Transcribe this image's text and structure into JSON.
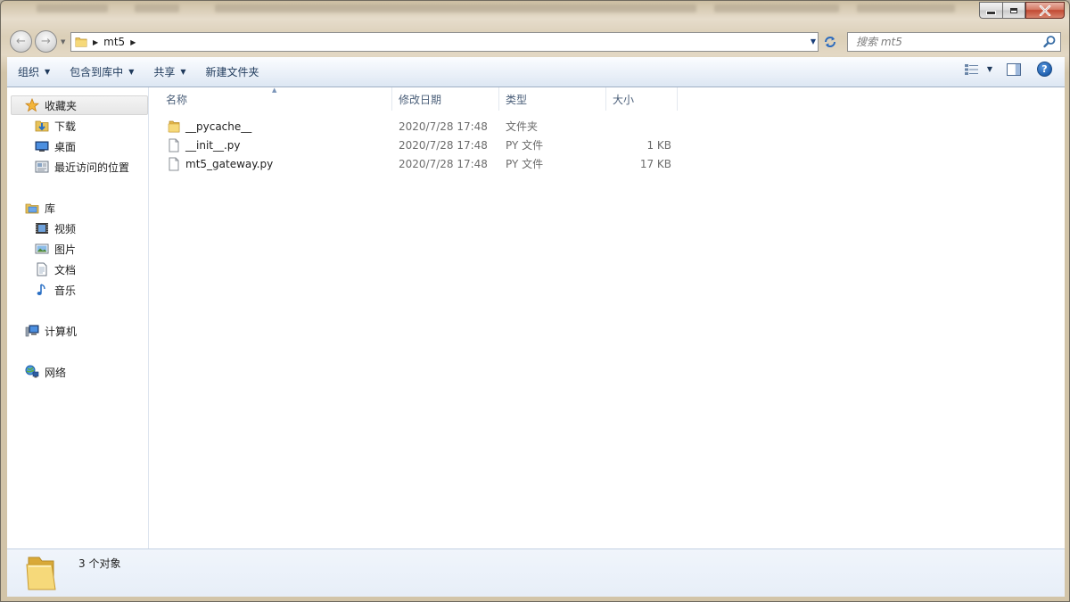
{
  "address": {
    "breadcrumbs": [
      "mt5"
    ],
    "search_placeholder": "搜索 mt5"
  },
  "toolbar": {
    "organize": "组织",
    "include_in_library": "包含到库中",
    "share": "共享",
    "new_folder": "新建文件夹"
  },
  "sidebar": {
    "favorites": {
      "label": "收藏夹",
      "items": [
        {
          "label": "下载",
          "icon": "download-folder-icon"
        },
        {
          "label": "桌面",
          "icon": "desktop-icon"
        },
        {
          "label": "最近访问的位置",
          "icon": "recent-places-icon"
        }
      ]
    },
    "libraries": {
      "label": "库",
      "items": [
        {
          "label": "视频",
          "icon": "videos-icon"
        },
        {
          "label": "图片",
          "icon": "pictures-icon"
        },
        {
          "label": "文档",
          "icon": "documents-icon"
        },
        {
          "label": "音乐",
          "icon": "music-icon"
        }
      ]
    },
    "computer": {
      "label": "计算机",
      "icon": "computer-icon"
    },
    "network": {
      "label": "网络",
      "icon": "network-icon"
    }
  },
  "columns": {
    "name": "名称",
    "date": "修改日期",
    "type": "类型",
    "size": "大小"
  },
  "files": [
    {
      "name": "__pycache__",
      "date": "2020/7/28 17:48",
      "type": "文件夹",
      "size": "",
      "icon": "folder-icon"
    },
    {
      "name": "__init__.py",
      "date": "2020/7/28 17:48",
      "type": "PY 文件",
      "size": "1 KB",
      "icon": "file-icon"
    },
    {
      "name": "mt5_gateway.py",
      "date": "2020/7/28 17:48",
      "type": "PY 文件",
      "size": "17 KB",
      "icon": "file-icon"
    }
  ],
  "details": {
    "count_text": "3 个对象"
  },
  "colors": {
    "command_bar_text": "#1e395b",
    "column_header_text": "#4c607a",
    "accent_blue": "#2c6bbd"
  }
}
